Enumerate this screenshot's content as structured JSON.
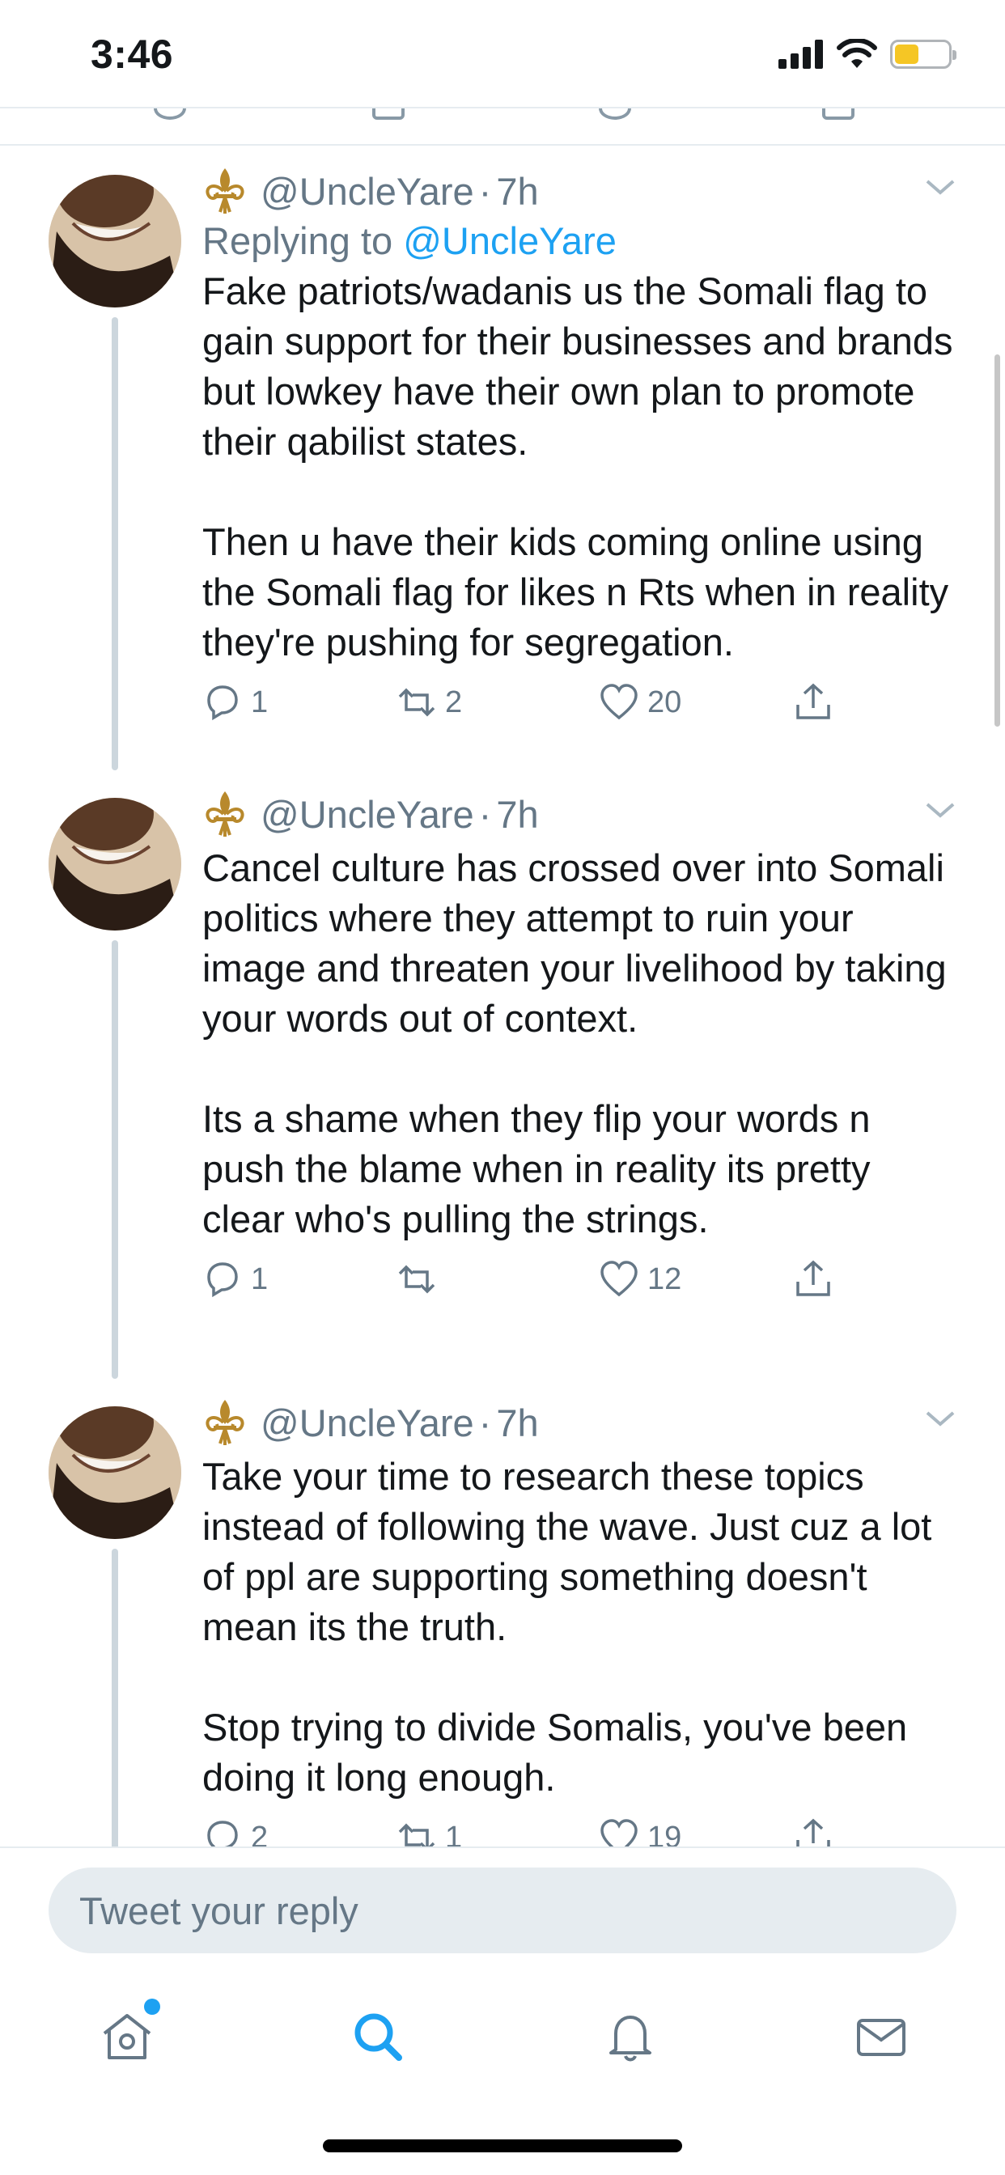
{
  "status_bar": {
    "time": "3:46",
    "battery_level": 0.45,
    "battery_color": "#f5c625"
  },
  "colors": {
    "accent": "#1da1f2",
    "secondary_text": "#657786",
    "primary_text": "#14171a",
    "thread_line": "#ccd6dd"
  },
  "thread": {
    "tweets": [
      {
        "handle": "@UncleYare",
        "time": "7h",
        "replying_prefix": "Replying to",
        "replying_to": "@UncleYare",
        "text": "Fake patriots/wadanis us the Somali flag to gain support for their businesses and brands but lowkey have their own plan to promote their qabilist states.\n\nThen u have their kids coming online using the Somali flag for likes n Rts when in reality they're pushing for segregation.",
        "replies": "1",
        "retweets": "2",
        "likes": "20"
      },
      {
        "handle": "@UncleYare",
        "time": "7h",
        "text": "Cancel culture has crossed over into Somali politics where they attempt to ruin your image and threaten your livelihood by taking your words out of context.\n\nIts a shame when they flip your words n push the blame when in reality its pretty clear who's pulling the strings.",
        "replies": "1",
        "retweets": "",
        "likes": "12"
      },
      {
        "handle": "@UncleYare",
        "time": "7h",
        "text": "Take your time to research these topics instead of following the wave. Just cuz a lot of ppl are supporting something doesn't mean its the truth.\n\nStop trying to divide Somalis, you've been doing it long enough.",
        "replies": "2",
        "retweets": "1",
        "likes": "19"
      }
    ]
  },
  "reply_bar": {
    "placeholder": "Tweet your reply"
  },
  "tab_bar": {
    "tabs": [
      {
        "name": "home-icon",
        "active": false,
        "badge": true
      },
      {
        "name": "search-icon",
        "active": true
      },
      {
        "name": "bell-icon",
        "active": false
      },
      {
        "name": "mail-icon",
        "active": false
      }
    ]
  }
}
